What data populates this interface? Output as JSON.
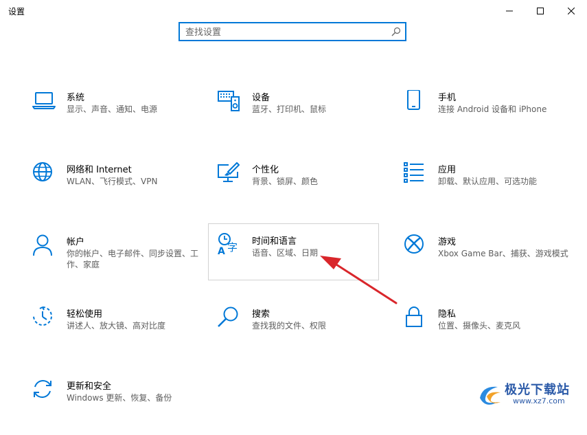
{
  "window": {
    "title": "设置"
  },
  "search": {
    "placeholder": "查找设置"
  },
  "tiles": [
    {
      "title": "系统",
      "desc": "显示、声音、通知、电源",
      "icon": "laptop-icon"
    },
    {
      "title": "设备",
      "desc": "蓝牙、打印机、鼠标",
      "icon": "keyboard-speaker-icon"
    },
    {
      "title": "手机",
      "desc": "连接 Android 设备和 iPhone",
      "icon": "phone-icon"
    },
    {
      "title": "网络和 Internet",
      "desc": "WLAN、飞行模式、VPN",
      "icon": "globe-icon"
    },
    {
      "title": "个性化",
      "desc": "背景、锁屏、颜色",
      "icon": "paint-monitor-icon"
    },
    {
      "title": "应用",
      "desc": "卸载、默认应用、可选功能",
      "icon": "app-list-icon"
    },
    {
      "title": "帐户",
      "desc": "你的帐户、电子邮件、同步设置、工作、家庭",
      "icon": "person-icon"
    },
    {
      "title": "时间和语言",
      "desc": "语音、区域、日期",
      "icon": "time-language-icon"
    },
    {
      "title": "游戏",
      "desc": "Xbox Game Bar、捕获、游戏模式",
      "icon": "xbox-icon"
    },
    {
      "title": "轻松使用",
      "desc": "讲述人、放大镜、高对比度",
      "icon": "ease-of-access-icon"
    },
    {
      "title": "搜索",
      "desc": "查找我的文件、权限",
      "icon": "search-icon"
    },
    {
      "title": "隐私",
      "desc": "位置、摄像头、麦克风",
      "icon": "lock-icon"
    },
    {
      "title": "更新和安全",
      "desc": "Windows 更新、恢复、备份",
      "icon": "sync-icon"
    }
  ],
  "watermark": {
    "name": "极光下载站",
    "url": "www.xz7.com"
  },
  "colors": {
    "accent": "#0078d7",
    "arrow": "#d9262b"
  }
}
